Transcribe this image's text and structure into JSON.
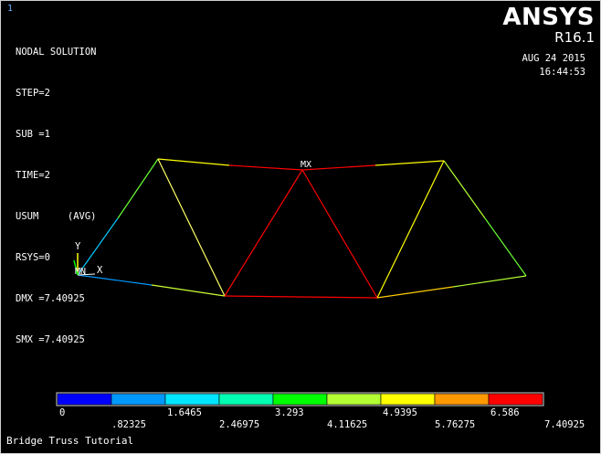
{
  "window_number": "1",
  "solution": {
    "title": "NODAL SOLUTION",
    "lines": [
      "STEP=2",
      "SUB =1",
      "TIME=2",
      "USUM     (AVG)",
      "RSYS=0",
      "DMX =7.40925",
      "SMX =7.40925"
    ]
  },
  "branding": {
    "logo": "ANSYS",
    "version": "R16.1",
    "date": "AUG 24 2015",
    "time": "16:44:53"
  },
  "markers": {
    "max_label": "MX",
    "min_label": "MN",
    "axis_x": "X",
    "axis_y": "Y"
  },
  "legend": {
    "colors": [
      "#0000ff",
      "#0099ff",
      "#00e5ff",
      "#00ffb3",
      "#00ff00",
      "#b3ff33",
      "#ffff00",
      "#ff9900",
      "#ff0000"
    ],
    "labels_top": [
      "0",
      "1.6465",
      "3.293",
      "4.9395",
      "6.586"
    ],
    "labels_bottom": [
      ".82325",
      "2.46975",
      "4.11625",
      "5.76275",
      "7.40925"
    ]
  },
  "footer": {
    "title": "Bridge Truss Tutorial"
  },
  "colors": {
    "text": "#ffffff",
    "background": "#000000",
    "window_number": "#66b3ff"
  }
}
